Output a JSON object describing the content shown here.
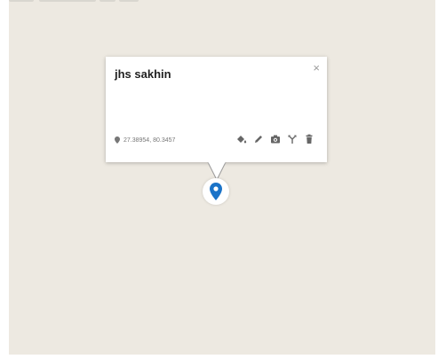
{
  "popup": {
    "title": "jhs sakhin",
    "coordinates": "27.38954, 80.3457",
    "close_glyph": "×",
    "actions": [
      {
        "name": "paint-bucket-icon"
      },
      {
        "name": "pencil-icon"
      },
      {
        "name": "camera-icon"
      },
      {
        "name": "directions-icon"
      },
      {
        "name": "trash-icon"
      }
    ]
  },
  "marker": {
    "icon": "map-pin-icon",
    "color": "#1a73c8"
  },
  "colors": {
    "map_background": "#ede9e1",
    "icon": "#666666"
  }
}
